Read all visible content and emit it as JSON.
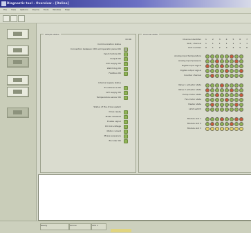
{
  "window": {
    "title": "Diagnostic tool - Overview - [Online]",
    "menu": [
      "File",
      "View",
      "Options",
      "Device",
      "Tools",
      "Window",
      "Help"
    ]
  },
  "sidebar": {
    "buttons": [
      "Overview",
      "Status",
      "Faults",
      "Tests",
      "Params",
      "Log"
    ]
  },
  "left_panel": {
    "title": "CPU/IO status",
    "col_header": "IO  OK",
    "groups": [
      {
        "rows": [
          {
            "label": "Communication status",
            "led": "none"
          },
          {
            "label": "Connection between CPU and operator panel OK",
            "led": "gray"
          },
          {
            "label": "Input module OK",
            "led": "green"
          },
          {
            "label": "Output OK",
            "led": "green"
          },
          {
            "label": "24V supply OK",
            "led": "green"
          },
          {
            "label": "Watchdog OK",
            "led": "green"
          },
          {
            "label": "Fieldbus OK",
            "led": "green"
          }
        ]
      },
      {
        "rows": [
          {
            "label": "Internal supply status",
            "led": "none"
          },
          {
            "label": "5V reference OK",
            "led": "green"
          },
          {
            "label": "12V supply OK",
            "led": "green"
          },
          {
            "label": "Temperature sensor OK",
            "led": "green"
          }
        ]
      },
      {
        "rows": [
          {
            "label": "Status of the drive system",
            "led": "none"
          },
          {
            "label": "Drive ready",
            "led": "green"
          },
          {
            "label": "Brake released",
            "led": "green"
          },
          {
            "label": "Enable signal",
            "led": "green"
          },
          {
            "label": "DC link voltage",
            "led": "green"
          },
          {
            "label": "Motor current",
            "led": "green"
          },
          {
            "label": "Phase sequence",
            "led": "green"
          },
          {
            "label": "Encoder OK",
            "led": "green"
          }
        ]
      }
    ]
  },
  "right_panel": {
    "title": "Channel state",
    "header_rows": [
      {
        "label": "Channel identifier",
        "values": "1 2 3 4 5 6 7 8"
      },
      {
        "label": "Slot / channel",
        "values": "1 1 1 1 1 1 1 1"
      },
      {
        "label": "Port number",
        "values": "0 1 2 3 4 5 6 7"
      }
    ],
    "groups": [
      {
        "rows": [
          {
            "label": "Analog input temperature",
            "dots": [
              "g",
              "g",
              "g",
              "g",
              "g",
              "r",
              "g",
              "g"
            ]
          },
          {
            "label": "Analog input pressure",
            "dots": [
              "g",
              "g",
              "r",
              "g",
              "g",
              "g",
              "r",
              "g"
            ]
          },
          {
            "label": "Digital input signal",
            "dots": [
              "r",
              "g",
              "g",
              "r",
              "g",
              "g",
              "g",
              "g"
            ]
          },
          {
            "label": "Digital output signal",
            "dots": [
              "g",
              "g",
              "g",
              "g",
              "r",
              "g",
              "g",
              "r"
            ]
          },
          {
            "label": "Counter channel",
            "dots": [
              "g",
              "r",
              "g",
              "g",
              "g",
              "g",
              "g",
              "g"
            ]
          }
        ]
      },
      {
        "rows": [
          {
            "label": "Valve 1 actuator state",
            "dots": [
              "g",
              "g",
              "g",
              "r",
              "g",
              "g",
              "g",
              "g"
            ]
          },
          {
            "label": "Valve 2 actuator state",
            "dots": [
              "r",
              "g",
              "g",
              "g",
              "g",
              "r",
              "g",
              "g"
            ]
          },
          {
            "label": "Pump motor state",
            "dots": [
              "g",
              "g",
              "r",
              "g",
              "g",
              "g",
              "g",
              "r"
            ]
          },
          {
            "label": "Fan motor state",
            "dots": [
              "g",
              "g",
              "g",
              "g",
              "r",
              "g",
              "g",
              "g"
            ]
          },
          {
            "label": "Heater state",
            "dots": [
              "g",
              "r",
              "g",
              "g",
              "g",
              "g",
              "r",
              "g"
            ]
          },
          {
            "label": "Limit switch",
            "dots": [
              "g",
              "g",
              "g",
              "g",
              "g",
              "g",
              "g",
              "g"
            ]
          }
        ]
      },
      {
        "rows": [
          {
            "label": "Module slot 1",
            "dots": [
              "g",
              "g",
              "g",
              "r",
              "g",
              "g",
              "r",
              "r"
            ]
          },
          {
            "label": "Module slot 2",
            "dots": [
              "g",
              "r",
              "g",
              "g",
              "g",
              "r",
              "g",
              "g"
            ]
          },
          {
            "label": "Module slot 3",
            "dots": [
              "y",
              "y",
              "y",
              "y",
              "y",
              "y",
              "y",
              "y"
            ]
          }
        ]
      }
    ]
  },
  "statusbar": {
    "cells": [
      "Ready",
      "Online",
      "CPU 1",
      "NUM"
    ]
  },
  "colors": {
    "green": "#8fb357",
    "red": "#c95a3c",
    "yellow": "#e6d36a",
    "gray": "#a7ab98"
  }
}
